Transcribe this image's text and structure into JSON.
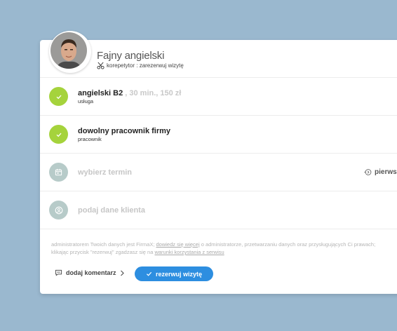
{
  "business": {
    "name": "Fajny angielski",
    "subtitle": "korepetytor : zarezerwuj wizytę"
  },
  "steps": [
    {
      "title": "angielski B2",
      "extra": " , 30 min., 150 zł",
      "subtitle": "usługa",
      "icon": "check-icon",
      "state": "done"
    },
    {
      "title": "dowolny pracownik firmy",
      "subtitle": "pracownik",
      "icon": "check-icon",
      "state": "done"
    },
    {
      "title": "wybierz termin",
      "icon": "calendar-icon",
      "state": "todo",
      "right_text": "pierwsz"
    },
    {
      "title": "podaj dane klienta",
      "icon": "user-icon",
      "state": "todo"
    }
  ],
  "legal": {
    "part1": "administratorem Twoich danych jest FirmaX; ",
    "link1": "dowiedz się więcej",
    "part2": " o administratorze,  przetwarzaniu danych oraz przysługujących Ci prawach;",
    "part3": "klikając przycisk \"rezerwuj\" zgadzasz się na ",
    "link2": "warunki korzystania z serwisu"
  },
  "actions": {
    "comment_label": "dodaj komentarz",
    "book_label": "rezerwuj wizytę"
  },
  "colors": {
    "background": "#9ab8cf",
    "done": "#a5d33c",
    "todo": "#b7cbc9",
    "primary": "#2d8ee0"
  }
}
